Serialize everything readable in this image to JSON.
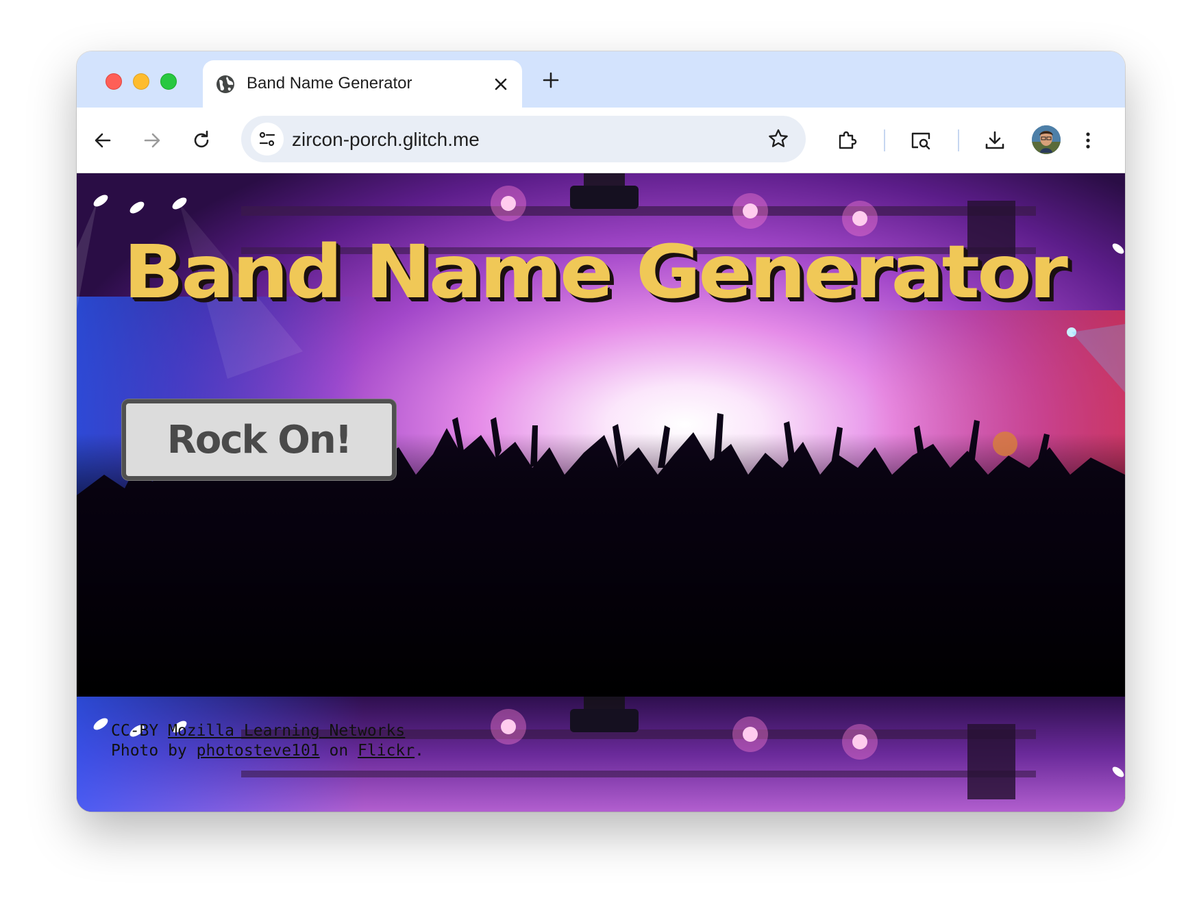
{
  "browser": {
    "tab_title": "Band Name Generator",
    "url": "zircon-porch.glitch.me"
  },
  "page": {
    "headline": "Band Name Generator",
    "button_label": "Rock On!",
    "credits": {
      "line1_prefix": "CC-BY ",
      "line1_link": "Mozilla Learning Networks",
      "line2_prefix": "Photo by ",
      "line2_link1": "photosteve101",
      "line2_middle": " on ",
      "line2_link2": "Flickr",
      "line2_suffix": "."
    }
  },
  "colors": {
    "headline": "#f0c857",
    "button_bg": "#dcdcdc",
    "tab_strip": "#d3e3fd"
  },
  "icons": [
    "globe-icon",
    "close-icon",
    "plus-icon",
    "back-arrow-icon",
    "forward-arrow-icon",
    "reload-icon",
    "site-settings-icon",
    "star-icon",
    "extensions-icon",
    "tab-search-icon",
    "download-icon",
    "avatar",
    "kebab-menu-icon"
  ]
}
